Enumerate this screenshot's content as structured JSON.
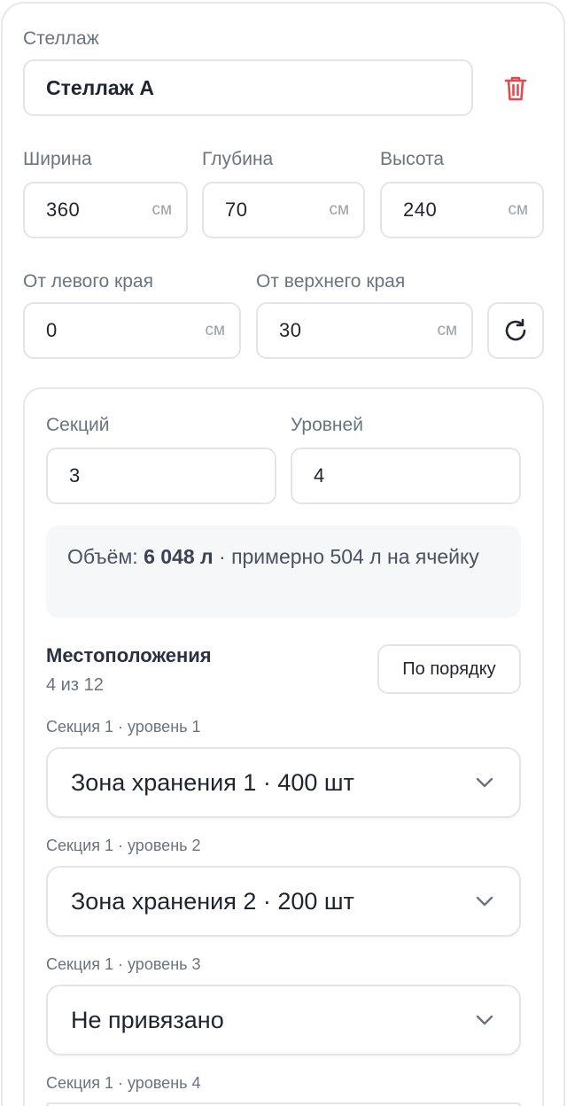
{
  "rack": {
    "label": "Стеллаж",
    "name": "Стеллаж А",
    "delete_icon": "trash-icon",
    "accent_color": "#e5484d"
  },
  "dimensions": {
    "width": {
      "label": "Ширина",
      "value": "360",
      "unit": "см"
    },
    "depth": {
      "label": "Глубина",
      "value": "70",
      "unit": "см"
    },
    "height": {
      "label": "Высота",
      "value": "240",
      "unit": "см"
    }
  },
  "position": {
    "left": {
      "label": "От левого края",
      "value": "0",
      "unit": "см"
    },
    "top": {
      "label": "От верхнего края",
      "value": "30",
      "unit": "см"
    },
    "reset_icon": "rotate-icon"
  },
  "grid": {
    "sections": {
      "label": "Секций",
      "value": "3"
    },
    "levels": {
      "label": "Уровней",
      "value": "4"
    }
  },
  "volume": {
    "prefix": "Объём:",
    "total": "6 048 л",
    "suffix": "· примерно 504 л на ячейку"
  },
  "locations": {
    "title": "Местоположения",
    "count": "4 из 12",
    "order_button": "По порядку",
    "slots": [
      {
        "label": "Секция 1 · уровень 1",
        "value": "Зона хранения 1 · 400 шт"
      },
      {
        "label": "Секция 1 · уровень 2",
        "value": "Зона хранения 2 · 200 шт"
      },
      {
        "label": "Секция 1 · уровень 3",
        "value": "Не привязано"
      },
      {
        "label": "Секция 1 · уровень 4",
        "value": ""
      }
    ]
  }
}
